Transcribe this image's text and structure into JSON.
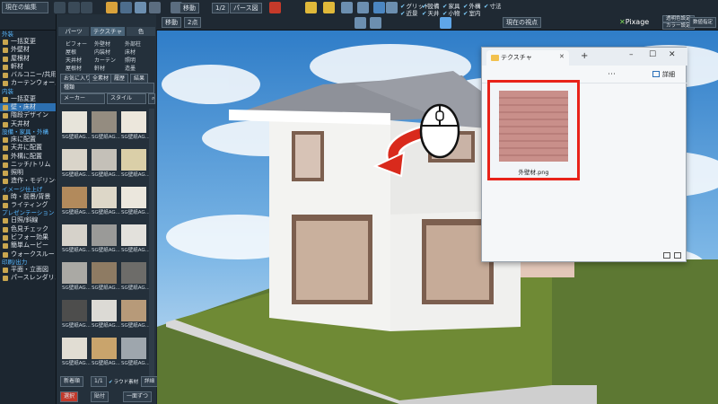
{
  "toolbar": {
    "project_title": "現在の編集",
    "floor_label": "全体",
    "check_row1": [
      "グリッド",
      "設備",
      "家具",
      "外構",
      "寸法"
    ],
    "check_row2": [
      "近景",
      "天井",
      "小物",
      "室内",
      "屋内"
    ],
    "move_label": "移動",
    "count_label": "2点",
    "zoom_value": "1/2",
    "pers_label": "パース図",
    "pixage_label": "Pixage",
    "viewpoint_label": "現在の視点",
    "right_btn1": "透明色設定",
    "right_btn2": "カラー設定",
    "right_btn3": "数値指定"
  },
  "sidebar": {
    "sections": [
      {
        "title": "外装",
        "items": [
          "一括変更",
          "外壁材",
          "屋根材",
          "軒材",
          "バルコニー/共用廊下",
          "カーテンウォール"
        ]
      },
      {
        "title": "内装",
        "items": [
          "一括変更",
          "壁・床材",
          "階段デザイン",
          "天井材"
        ]
      },
      {
        "title": "設備・家具・外構",
        "items": [
          "床に配置",
          "天井に配置",
          "外構に配置",
          "ニッチ/トリム",
          "照明",
          "造作・モデリング"
        ]
      },
      {
        "title": "イメージ仕上げ",
        "items": [
          "時・前景/背景",
          "ライティング"
        ]
      },
      {
        "title": "プレゼンテーション",
        "items": [
          "日照/斜線",
          "色見チェック",
          "ビフォー効果",
          "簡単ムービー",
          "ウォークスルー"
        ]
      },
      {
        "title": "印刷/出力",
        "items": [
          "平面・立面図",
          "パースレンダリング"
        ]
      }
    ],
    "active_item": "壁・床材"
  },
  "panel": {
    "dropdown": "全体",
    "tabs": [
      "パーツ",
      "テクスチャ",
      "色"
    ],
    "active_tab": "テクスチャ",
    "categories": [
      "ビフォー",
      "外壁材",
      "外部柱",
      "屋根",
      "内装材",
      "床材",
      "天井材",
      "カーテン",
      "照明",
      "屋根材",
      "軒材",
      "造墨"
    ],
    "filter_tabs": [
      "お気に入り",
      "全素材",
      "履歴",
      "結果"
    ],
    "kind_label": "種類",
    "maker_label": "メーカー",
    "style_label": "スタイル",
    "material_label": "SG壁紙AG...",
    "footer_sort": "新着順",
    "footer_page": "1/1",
    "footer_check": "ラウド素材",
    "footer_detail": "詳細",
    "bottom_left": "選択",
    "bottom_mid": "貼付",
    "bottom_right": "一面ずつ"
  },
  "explorer": {
    "tab_title": "テクスチャ",
    "new_tab": "+",
    "detail_label": "詳細",
    "file_name": "外壁材.png"
  },
  "colors": {
    "accent": "#2c6fb0",
    "highlight_border": "#e8231a",
    "arrow": "#d92a1c",
    "grass": "#6f8a35",
    "sky": "#4a95d6"
  }
}
